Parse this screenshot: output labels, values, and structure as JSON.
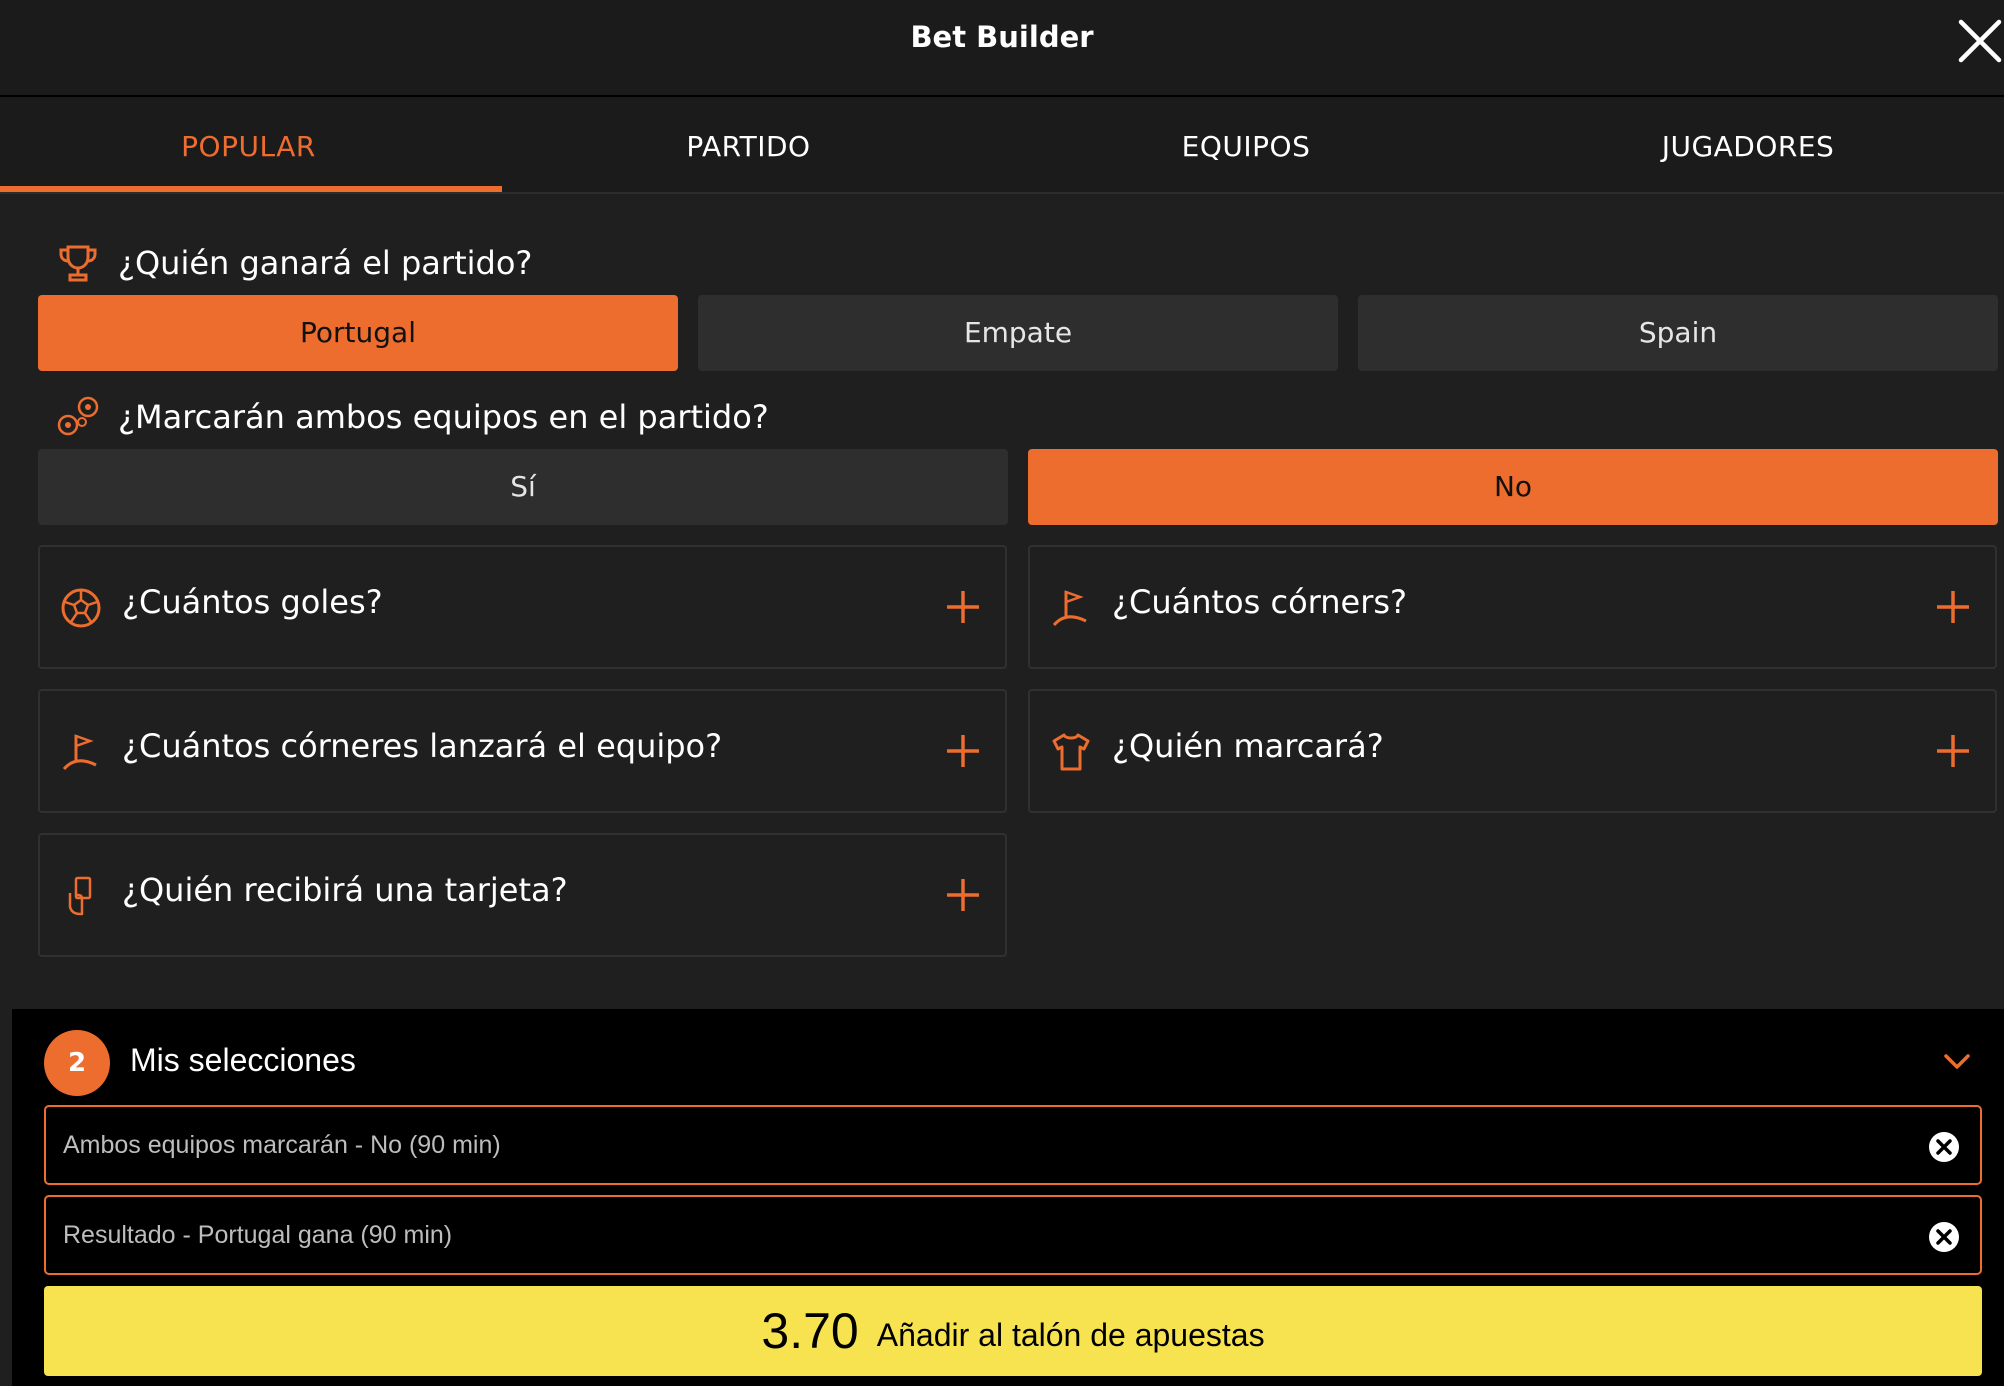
{
  "header": {
    "title": "Bet Builder"
  },
  "tabs": [
    {
      "label": "POPULAR",
      "active": true
    },
    {
      "label": "PARTIDO",
      "active": false
    },
    {
      "label": "EQUIPOS",
      "active": false
    },
    {
      "label": "JUGADORES",
      "active": false
    }
  ],
  "match_winner": {
    "question": "¿Quién ganará el partido?",
    "icon": "trophy-icon",
    "options": [
      {
        "label": "Portugal",
        "selected": true
      },
      {
        "label": "Empate",
        "selected": false
      },
      {
        "label": "Spain",
        "selected": false
      }
    ]
  },
  "both_score": {
    "question": "¿Marcarán ambos equipos en el partido?",
    "icon": "balls-icon",
    "options": [
      {
        "label": "Sí",
        "selected": false
      },
      {
        "label": "No",
        "selected": true
      }
    ]
  },
  "markets": [
    {
      "label": "¿Cuántos goles?",
      "icon": "football-icon"
    },
    {
      "label": "¿Cuántos córners?",
      "icon": "corner-flag-icon"
    },
    {
      "label": "¿Cuántos córneres lanzará el equipo?",
      "icon": "corner-flag-icon"
    },
    {
      "label": "¿Quién marcará?",
      "icon": "shirt-icon"
    },
    {
      "label": "¿Quién recibirá una tarjeta?",
      "icon": "card-hand-icon"
    }
  ],
  "selections": {
    "count": "2",
    "title": "Mis selecciones",
    "items": [
      {
        "label": "Ambos equipos marcarán - No (90 min)"
      },
      {
        "label": "Resultado - Portugal gana (90 min)"
      }
    ]
  },
  "add_to_slip": {
    "odds": "3.70",
    "label": "Añadir al talón de apuestas"
  },
  "colors": {
    "accent": "#ed6d2e",
    "cta": "#f7e34f",
    "background": "#1f1f1f"
  }
}
